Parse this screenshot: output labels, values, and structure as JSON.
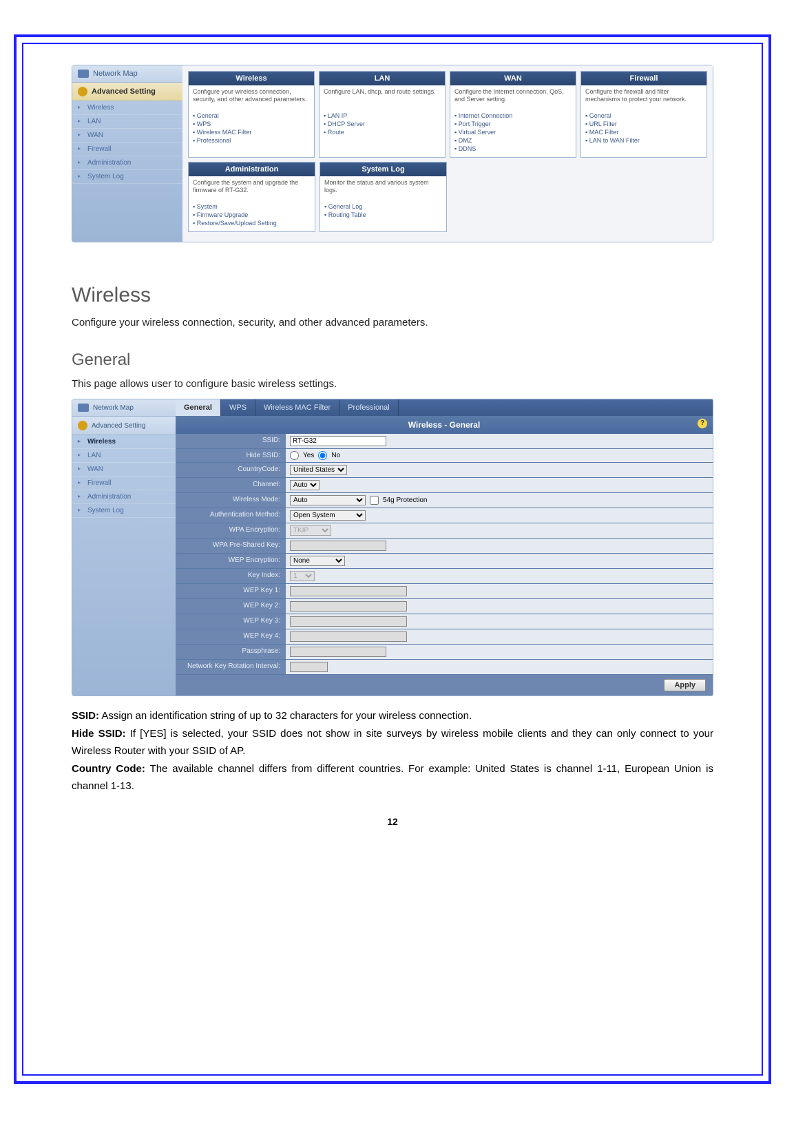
{
  "screenshot1": {
    "sidebar": {
      "network_map": "Network Map",
      "advanced_setting": "Advanced Setting",
      "items": [
        "Wireless",
        "LAN",
        "WAN",
        "Firewall",
        "Administration",
        "System Log"
      ]
    },
    "categories": [
      {
        "title": "Wireless",
        "desc": "Configure your wireless connection, security, and other advanced parameters.",
        "links": [
          "General",
          "WPS",
          "Wireless MAC Filter",
          "Professional"
        ]
      },
      {
        "title": "LAN",
        "desc": "Configure LAN, dhcp, and route settings.",
        "links": [
          "LAN IP",
          "DHCP Server",
          "Route"
        ]
      },
      {
        "title": "WAN",
        "desc": "Configure the Internet connection, QoS, and Server setting.",
        "links": [
          "Internet Connection",
          "Port Trigger",
          "Virtual Server",
          "DMZ",
          "DDNS"
        ]
      },
      {
        "title": "Firewall",
        "desc": "Configure the firewall and filter mechanisms to protect your network.",
        "links": [
          "General",
          "URL Filter",
          "MAC Filter",
          "LAN to WAN Filter"
        ]
      },
      {
        "title": "Administration",
        "desc": "Configure the system and upgrade the firmware of RT-G32.",
        "links": [
          "System",
          "Firmware Upgrade",
          "Restore/Save/Upload Setting"
        ]
      },
      {
        "title": "System Log",
        "desc": "Monitor the status and various system logs.",
        "links": [
          "General Log",
          "Routing Table"
        ]
      }
    ]
  },
  "section1": {
    "heading": "Wireless",
    "text": "Configure your wireless connection, security, and other advanced parameters."
  },
  "section2": {
    "heading": "General",
    "text": "This page allows user to configure basic wireless settings."
  },
  "screenshot2": {
    "sidebar": {
      "network_map": "Network Map",
      "advanced_setting": "Advanced Setting",
      "items": [
        "Wireless",
        "LAN",
        "WAN",
        "Firewall",
        "Administration",
        "System Log"
      ],
      "active": "Wireless"
    },
    "tabs": [
      "General",
      "WPS",
      "Wireless MAC Filter",
      "Professional"
    ],
    "active_tab": "General",
    "panel_title": "Wireless - General",
    "fields": {
      "ssid": {
        "label": "SSID:",
        "value": "RT-G32"
      },
      "hide_ssid": {
        "label": "Hide SSID:",
        "yes": "Yes",
        "no": "No"
      },
      "country": {
        "label": "CountryCode:",
        "value": "United States"
      },
      "channel": {
        "label": "Channel:",
        "value": "Auto"
      },
      "wireless_mode": {
        "label": "Wireless Mode:",
        "value": "Auto",
        "checkbox": "54g Protection"
      },
      "auth": {
        "label": "Authentication Method:",
        "value": "Open System"
      },
      "wpa_enc": {
        "label": "WPA Encryption:",
        "value": "TKIP"
      },
      "wpa_psk": {
        "label": "WPA Pre-Shared Key:"
      },
      "wep_enc": {
        "label": "WEP Encryption:",
        "value": "None"
      },
      "key_index": {
        "label": "Key Index:",
        "value": "1"
      },
      "wep1": {
        "label": "WEP Key 1:"
      },
      "wep2": {
        "label": "WEP Key 2:"
      },
      "wep3": {
        "label": "WEP Key 3:"
      },
      "wep4": {
        "label": "WEP Key 4:"
      },
      "pass": {
        "label": "Passphrase:"
      },
      "rotation": {
        "label": "Network Key Rotation Interval:"
      }
    },
    "apply": "Apply"
  },
  "descriptions": {
    "ssid": {
      "label": "SSID:",
      "text": " Assign an identification string of up to 32 characters for your wireless connection."
    },
    "hide": {
      "label": "Hide SSID:",
      "text": " If [YES] is selected, your SSID does not show in site surveys by wireless mobile clients and they can only connect to your Wireless Router with your SSID of AP."
    },
    "country": {
      "label": "Country Code:",
      "text": " The available channel differs from different countries. For example: United States is channel 1-11, European Union is channel 1-13."
    }
  },
  "page_number": "12"
}
